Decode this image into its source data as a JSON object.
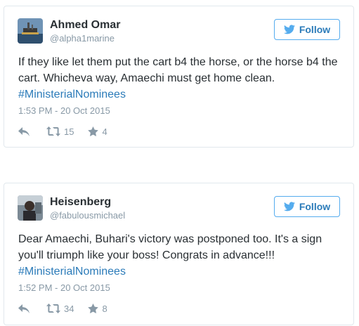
{
  "colors": {
    "link": "#2b7bb9",
    "follow_border": "#55acee",
    "muted": "#8899a6",
    "text": "#292f33",
    "card_border": "#e1e8ed"
  },
  "icons": {
    "follow": "twitter-bird-icon",
    "reply": "reply-icon",
    "retweet": "retweet-icon",
    "favorite": "star-icon"
  },
  "tweets": [
    {
      "name": "Ahmed Omar",
      "handle": "@alpha1marine",
      "follow_label": "Follow",
      "text": "If they like let them put the cart b4 the horse, or the horse b4 the cart. Whicheva way, Amaechi must get home clean.",
      "hashtag": "#MinisterialNominees",
      "timestamp": "1:53 PM - 20 Oct 2015",
      "retweets": "15",
      "favorites": "4"
    },
    {
      "name": "Heisenberg",
      "handle": "@fabulousmichael",
      "follow_label": "Follow",
      "text": "Dear Amaechi, Buhari's victory was postponed too. It's a sign you'll triumph like your boss! Congrats in advance!!!",
      "hashtag": "#MinisterialNominees",
      "timestamp": "1:52 PM - 20 Oct 2015",
      "retweets": "34",
      "favorites": "8"
    }
  ]
}
